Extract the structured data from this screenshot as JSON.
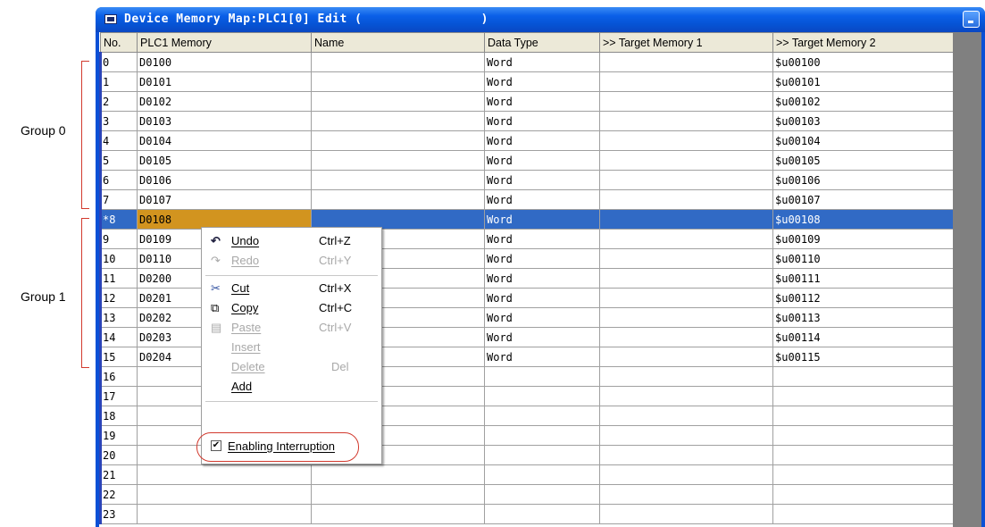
{
  "annotations": {
    "group0": "Group 0",
    "group1": "Group 1"
  },
  "window": {
    "title": "Device Memory Map:PLC1[0] Edit (                )"
  },
  "table": {
    "headers": [
      "No.",
      "PLC1 Memory",
      "Name",
      "Data Type",
      ">> Target Memory 1",
      ">> Target Memory 2"
    ],
    "rows": [
      [
        "0",
        "D0100",
        "",
        "Word",
        "",
        "$u00100"
      ],
      [
        "1",
        "D0101",
        "",
        "Word",
        "",
        "$u00101"
      ],
      [
        "2",
        "D0102",
        "",
        "Word",
        "",
        "$u00102"
      ],
      [
        "3",
        "D0103",
        "",
        "Word",
        "",
        "$u00103"
      ],
      [
        "4",
        "D0104",
        "",
        "Word",
        "",
        "$u00104"
      ],
      [
        "5",
        "D0105",
        "",
        "Word",
        "",
        "$u00105"
      ],
      [
        "6",
        "D0106",
        "",
        "Word",
        "",
        "$u00106"
      ],
      [
        "7",
        "D0107",
        "",
        "Word",
        "",
        "$u00107"
      ],
      [
        "*8",
        "D0108",
        "",
        "Word",
        "",
        "$u00108"
      ],
      [
        "9",
        "D0109",
        "",
        "Word",
        "",
        "$u00109"
      ],
      [
        "10",
        "D0110",
        "",
        "Word",
        "",
        "$u00110"
      ],
      [
        "11",
        "D0200",
        "",
        "Word",
        "",
        "$u00111"
      ],
      [
        "12",
        "D0201",
        "",
        "Word",
        "",
        "$u00112"
      ],
      [
        "13",
        "D0202",
        "",
        "Word",
        "",
        "$u00113"
      ],
      [
        "14",
        "D0203",
        "",
        "Word",
        "",
        "$u00114"
      ],
      [
        "15",
        "D0204",
        "",
        "Word",
        "",
        "$u00115"
      ],
      [
        "16",
        "",
        "",
        "",
        "",
        ""
      ],
      [
        "17",
        "",
        "",
        "",
        "",
        ""
      ],
      [
        "18",
        "",
        "",
        "",
        "",
        ""
      ],
      [
        "19",
        "",
        "",
        "",
        "",
        ""
      ],
      [
        "20",
        "",
        "",
        "",
        "",
        ""
      ],
      [
        "21",
        "",
        "",
        "",
        "",
        ""
      ],
      [
        "22",
        "",
        "",
        "",
        "",
        ""
      ],
      [
        "23",
        "",
        "",
        "",
        "",
        ""
      ]
    ]
  },
  "context_menu": {
    "items": [
      {
        "label": "Undo",
        "shortcut": "Ctrl+Z",
        "icon": "undo-icon",
        "glyph": "↶"
      },
      {
        "label": "Redo",
        "shortcut": "Ctrl+Y",
        "icon": "redo-icon",
        "glyph": "↷"
      },
      {
        "label": "Cut",
        "shortcut": "Ctrl+X",
        "icon": "scissors-icon",
        "glyph": "✂"
      },
      {
        "label": "Copy",
        "shortcut": "Ctrl+C",
        "icon": "copy-icon",
        "glyph": "⧉"
      },
      {
        "label": "Paste",
        "shortcut": "Ctrl+V",
        "icon": "paste-icon",
        "glyph": "▤"
      },
      {
        "label": "Insert",
        "shortcut": ""
      },
      {
        "label": "Delete",
        "shortcut": "Del"
      },
      {
        "label": "Add",
        "shortcut": ""
      },
      {
        "label": "Enabling Interruption",
        "shortcut": "",
        "checked": "✔"
      }
    ]
  },
  "colors": {
    "accent": "#d23a2e",
    "selection": "#316ac5",
    "active_cell": "#d2941f",
    "titlebar": "#0a5fe8"
  }
}
